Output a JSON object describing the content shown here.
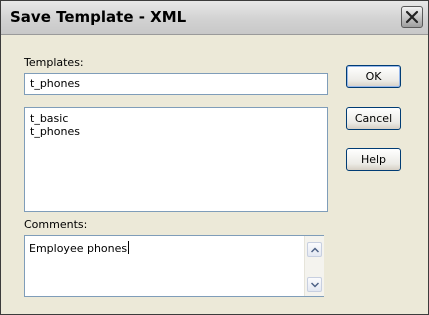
{
  "window": {
    "title": "Save Template - XML"
  },
  "templates": {
    "label": "Templates:",
    "value": "t_phones",
    "list": [
      "t_basic",
      "t_phones"
    ]
  },
  "comments": {
    "label": "Comments:",
    "value": "Employee phones"
  },
  "buttons": {
    "ok": "OK",
    "cancel": "Cancel",
    "help": "Help"
  },
  "icons": {
    "close": "close-icon",
    "scroll_up": "chevron-up-icon",
    "scroll_down": "chevron-down-icon"
  },
  "colors": {
    "dialog_background": "#ece9d8",
    "field_border": "#7f9db9",
    "button_border": "#003c74"
  }
}
